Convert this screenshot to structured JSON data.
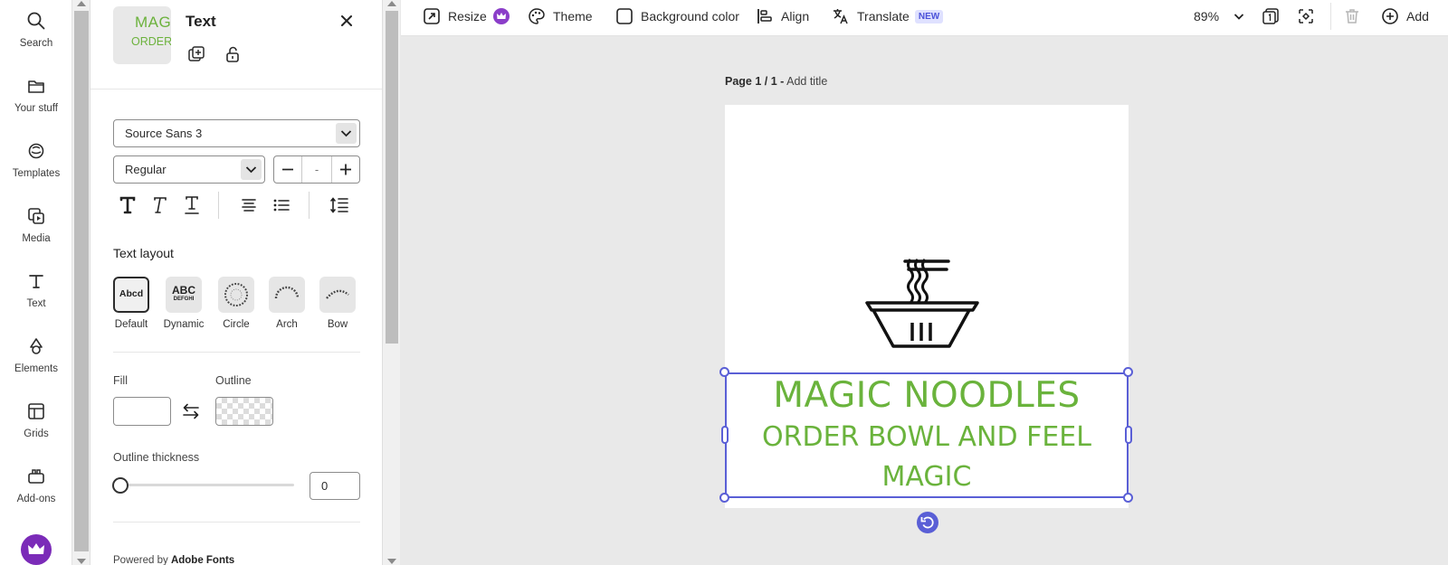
{
  "rail": {
    "items": [
      {
        "label": "Search",
        "icon": "search-icon"
      },
      {
        "label": "Your stuff",
        "icon": "folder-icon"
      },
      {
        "label": "Templates",
        "icon": "templates-icon"
      },
      {
        "label": "Media",
        "icon": "media-icon"
      },
      {
        "label": "Text",
        "icon": "text-icon"
      },
      {
        "label": "Elements",
        "icon": "elements-icon"
      },
      {
        "label": "Grids",
        "icon": "grids-icon"
      },
      {
        "label": "Add-ons",
        "icon": "add-ons-icon"
      }
    ],
    "premium_icon": "crown-icon"
  },
  "panel": {
    "title": "Text",
    "thumbnail": {
      "line1": "MAGIC",
      "line2": "ORDER"
    },
    "font_family": "Source Sans 3",
    "font_weight": "Regular",
    "font_size": "-",
    "text_layout": {
      "title": "Text layout",
      "options": [
        {
          "label": "Default",
          "preview": "Abcd",
          "selected": true
        },
        {
          "label": "Dynamic",
          "preview": "ABC",
          "preview2": "DEFGHI",
          "selected": false
        },
        {
          "label": "Circle",
          "preview": "ABCDEFG",
          "selected": false
        },
        {
          "label": "Arch",
          "preview": "ABCDEFG",
          "selected": false
        },
        {
          "label": "Bow",
          "preview": "ABCDEFG",
          "selected": false
        }
      ]
    },
    "fill_label": "Fill",
    "outline_label": "Outline",
    "fill_color": "#ffffff",
    "outline_thickness_label": "Outline thickness",
    "outline_thickness_value": "0",
    "outline_thickness_level": 0,
    "powered_prefix": "Powered by",
    "powered_brand": "Adobe Fonts"
  },
  "toolbar": {
    "resize": "Resize",
    "theme": "Theme",
    "background_color": "Background color",
    "align": "Align",
    "translate": "Translate",
    "translate_badge": "NEW",
    "zoom": "89%",
    "add": "Add"
  },
  "canvas": {
    "page_label": "Page 1 / 1 -",
    "add_title": "Add title",
    "text_line1": "MAGIC NOODLES",
    "text_line2": "ORDER BOWL AND FEEL",
    "text_line3": "MAGIC",
    "text_color": "#6ab33c",
    "selection_color": "#5a5fd6"
  }
}
